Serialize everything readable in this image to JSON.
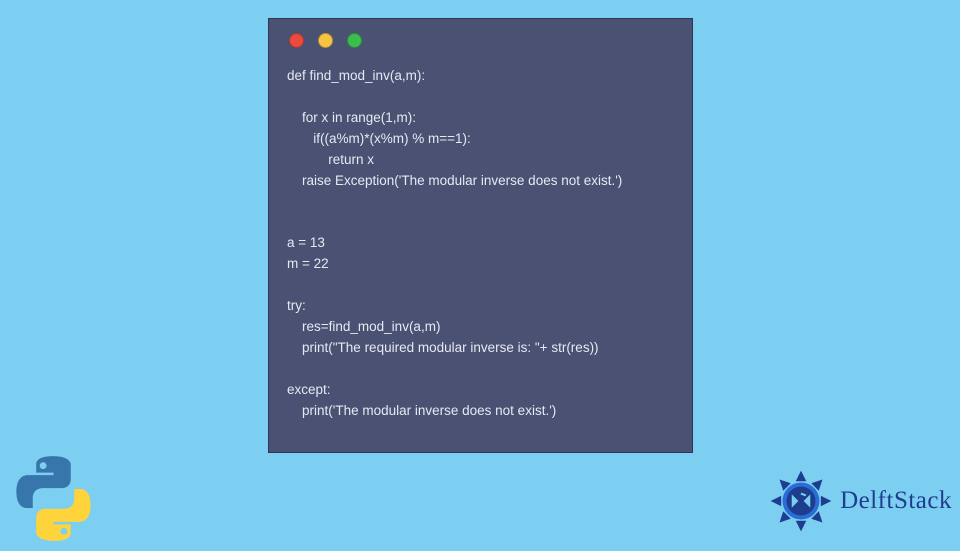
{
  "code_block": {
    "traffic_lights": [
      "red",
      "yellow",
      "green"
    ],
    "code": "def find_mod_inv(a,m):\n\n    for x in range(1,m):\n       if((a%m)*(x%m) % m==1):\n           return x\n    raise Exception('The modular inverse does not exist.')\n\n\na = 13\nm = 22\n\ntry:\n    res=find_mod_inv(a,m)\n    print(\"The required modular inverse is: \"+ str(res))\n\nexcept:\n    print('The modular inverse does not exist.')"
  },
  "branding": {
    "site_name": "DelftStack",
    "python_logo_alt": "Python logo"
  },
  "colors": {
    "page_bg": "#7dcff2",
    "card_bg": "#4a5173",
    "code_text": "#e6e9f2",
    "brand_text": "#1f3d8f"
  }
}
